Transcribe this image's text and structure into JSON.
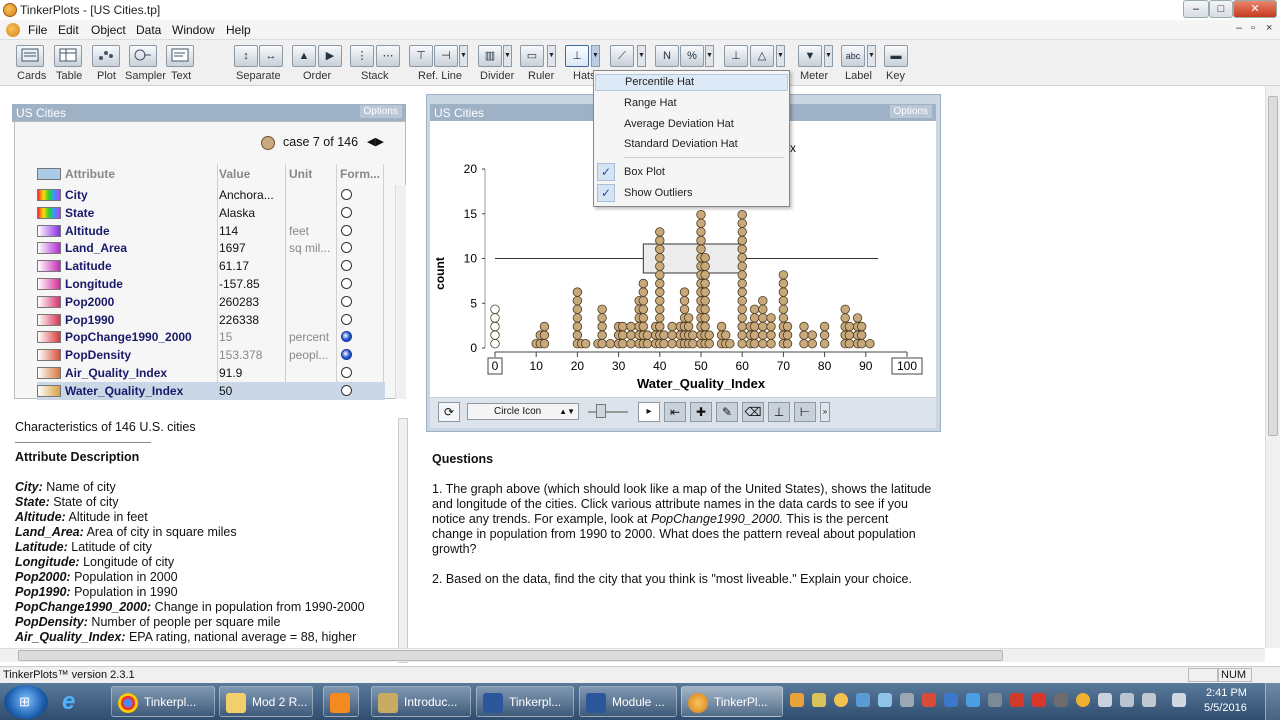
{
  "window": {
    "title": "TinkerPlots - [US Cities.tp]",
    "controls": [
      "–",
      "□",
      "✕"
    ],
    "doc_controls": [
      "–",
      "▫",
      "×"
    ]
  },
  "menu": [
    "File",
    "Edit",
    "Object",
    "Data",
    "Window",
    "Help"
  ],
  "toolbar": {
    "labels": [
      "Cards",
      "Table",
      "Plot",
      "Sampler",
      "Text",
      "Separate",
      "Order",
      "Stack",
      "Ref. Line",
      "Divider",
      "Ruler",
      "Hats",
      "Meter",
      "Label",
      "Key"
    ],
    "button_glyphs": [
      "N",
      "%",
      "abc"
    ]
  },
  "card": {
    "title": "US Cities",
    "options_label": "Options",
    "case_label": "case 7 of 146",
    "headers": {
      "attribute": "Attribute",
      "value": "Value",
      "unit": "Unit",
      "formula": "Form..."
    },
    "rows": [
      {
        "name": "City",
        "value": "Anchora...",
        "unit": "",
        "swatch": "linear-gradient(90deg,#e33,#fd0,#3c3,#39f,#c3f)",
        "formula_filled": false
      },
      {
        "name": "State",
        "value": "Alaska",
        "unit": "",
        "swatch": "linear-gradient(90deg,#e33,#fd0,#3c3,#39f,#c3f)",
        "formula_filled": false
      },
      {
        "name": "Altitude",
        "value": "114",
        "unit": "feet",
        "swatch": "linear-gradient(90deg,#fff,#8a2be2)",
        "formula_filled": false
      },
      {
        "name": "Land_Area",
        "value": "1697",
        "unit": "sq mil...",
        "swatch": "linear-gradient(90deg,#fff,#b02bd6)",
        "formula_filled": false
      },
      {
        "name": "Latitude",
        "value": "61.17",
        "unit": "",
        "swatch": "linear-gradient(90deg,#fff,#c42bb8)",
        "formula_filled": false
      },
      {
        "name": "Longitude",
        "value": "-157.85",
        "unit": "",
        "swatch": "linear-gradient(90deg,#fff,#d42b9a)",
        "formula_filled": false
      },
      {
        "name": "Pop2000",
        "value": "260283",
        "unit": "",
        "swatch": "linear-gradient(90deg,#fff,#d83070)",
        "formula_filled": false
      },
      {
        "name": "Pop1990",
        "value": "226338",
        "unit": "",
        "swatch": "linear-gradient(90deg,#fff,#d83050)",
        "formula_filled": false
      },
      {
        "name": "PopChange1990_2000",
        "value": "15",
        "unit": "percent",
        "swatch": "linear-gradient(90deg,#fff,#d83a3a)",
        "formula_filled": true
      },
      {
        "name": "PopDensity",
        "value": "153.378",
        "unit": "peopl...",
        "swatch": "linear-gradient(90deg,#fff,#d8503a)",
        "formula_filled": true
      },
      {
        "name": "Air_Quality_Index",
        "value": "91.9",
        "unit": "",
        "swatch": "linear-gradient(90deg,#fff,#d8783a)",
        "formula_filled": false
      },
      {
        "name": "Water_Quality_Index",
        "value": "50",
        "unit": "",
        "swatch": "linear-gradient(90deg,#fff,#d8a040)",
        "formula_filled": false
      }
    ]
  },
  "plot": {
    "title": "US Cities",
    "options_label": "Options",
    "icon_select": "Circle Icon",
    "visible_title_fragment": "x"
  },
  "hats_menu": {
    "items": [
      "Percentile Hat",
      "Range Hat",
      "Average Deviation Hat",
      "Standard Deviation Hat"
    ],
    "checked_items": [
      "Box Plot",
      "Show Outliers"
    ],
    "check_glyph": "✓"
  },
  "chart_data": {
    "type": "scatter",
    "title": "",
    "xlabel": "Water_Quality_Index",
    "ylabel": "count",
    "xlim": [
      0,
      100
    ],
    "ylim": [
      0,
      20
    ],
    "x_ticks": [
      0,
      10,
      20,
      30,
      40,
      50,
      60,
      70,
      80,
      90,
      100
    ],
    "y_ticks": [
      0,
      5,
      10,
      15,
      20
    ],
    "dot_stacks": [
      {
        "x": 0,
        "count": 5
      },
      {
        "x": 10,
        "count": 1
      },
      {
        "x": 11,
        "count": 2
      },
      {
        "x": 12,
        "count": 3
      },
      {
        "x": 20,
        "count": 7
      },
      {
        "x": 21,
        "count": 1
      },
      {
        "x": 22,
        "count": 1
      },
      {
        "x": 25,
        "count": 1
      },
      {
        "x": 26,
        "count": 5
      },
      {
        "x": 28,
        "count": 1
      },
      {
        "x": 30,
        "count": 3
      },
      {
        "x": 31,
        "count": 3
      },
      {
        "x": 33,
        "count": 3
      },
      {
        "x": 35,
        "count": 6
      },
      {
        "x": 36,
        "count": 8
      },
      {
        "x": 37,
        "count": 2
      },
      {
        "x": 39,
        "count": 3
      },
      {
        "x": 40,
        "count": 14
      },
      {
        "x": 41,
        "count": 2
      },
      {
        "x": 43,
        "count": 3
      },
      {
        "x": 45,
        "count": 3
      },
      {
        "x": 46,
        "count": 7
      },
      {
        "x": 47,
        "count": 4
      },
      {
        "x": 48,
        "count": 2
      },
      {
        "x": 50,
        "count": 16
      },
      {
        "x": 51,
        "count": 11
      },
      {
        "x": 52,
        "count": 2
      },
      {
        "x": 55,
        "count": 3
      },
      {
        "x": 56,
        "count": 2
      },
      {
        "x": 57,
        "count": 1
      },
      {
        "x": 60,
        "count": 16
      },
      {
        "x": 62,
        "count": 3
      },
      {
        "x": 63,
        "count": 5
      },
      {
        "x": 65,
        "count": 6
      },
      {
        "x": 67,
        "count": 4
      },
      {
        "x": 70,
        "count": 9
      },
      {
        "x": 71,
        "count": 3
      },
      {
        "x": 75,
        "count": 3
      },
      {
        "x": 77,
        "count": 2
      },
      {
        "x": 80,
        "count": 3
      },
      {
        "x": 85,
        "count": 5
      },
      {
        "x": 86,
        "count": 3
      },
      {
        "x": 88,
        "count": 4
      },
      {
        "x": 89,
        "count": 3
      },
      {
        "x": 91,
        "count": 1
      }
    ],
    "box_plot": {
      "whisker_low": 0,
      "q1": 36,
      "median": 50,
      "q3": 60,
      "whisker_high": 93
    },
    "grid": false,
    "legend": "none",
    "dot_color": "#c9a97b"
  },
  "left_doc": {
    "title": "Characteristics of 146 U.S. cities",
    "heading": "Attribute Description",
    "entries": [
      {
        "k": "City:",
        "v": "Name of city"
      },
      {
        "k": "State:",
        "v": "State of city"
      },
      {
        "k": "Altitude:",
        "v": "Altitude in feet"
      },
      {
        "k": "Land_Area:",
        "v": "Area of city in square miles"
      },
      {
        "k": "Latitude:",
        "v": "Latitude of city"
      },
      {
        "k": "Longitude:",
        "v": "Longitude of city"
      },
      {
        "k": "Pop2000:",
        "v": "Population in 2000"
      },
      {
        "k": "Pop1990:",
        "v": "Population in 1990"
      },
      {
        "k": "PopChange1990_2000:",
        "v": "Change in population from 1990-2000"
      },
      {
        "k": "PopDensity:",
        "v": "Number of people per square mile"
      },
      {
        "k": "Air_Quality_Index:",
        "v": "EPA rating, national average = 88, higher"
      }
    ]
  },
  "questions": {
    "heading": "Questions",
    "q1_before": "1.  The graph above (which should look like a map of the United States), shows the latitude and longitude of the cities. Click various attribute names in the data cards to see if you notice any trends. For example, look at ",
    "q1_italic": "PopChange1990_2000.",
    "q1_after": " This is the percent change in population from 1990 to 2000. What does the pattern reveal about population growth?",
    "q2": "2.  Based on the data, find the city that you think is \"most liveable.\" Explain your choice."
  },
  "status": {
    "version": "TinkerPlots™ version 2.3.1",
    "num": "NUM"
  },
  "taskbar": {
    "tasks": [
      "Tinkerpl...",
      "Mod 2 R...",
      "Introduc...",
      "Tinkerpl...",
      "Module ...",
      "TinkerPl..."
    ],
    "time": "2:41 PM",
    "date": "5/5/2016"
  }
}
